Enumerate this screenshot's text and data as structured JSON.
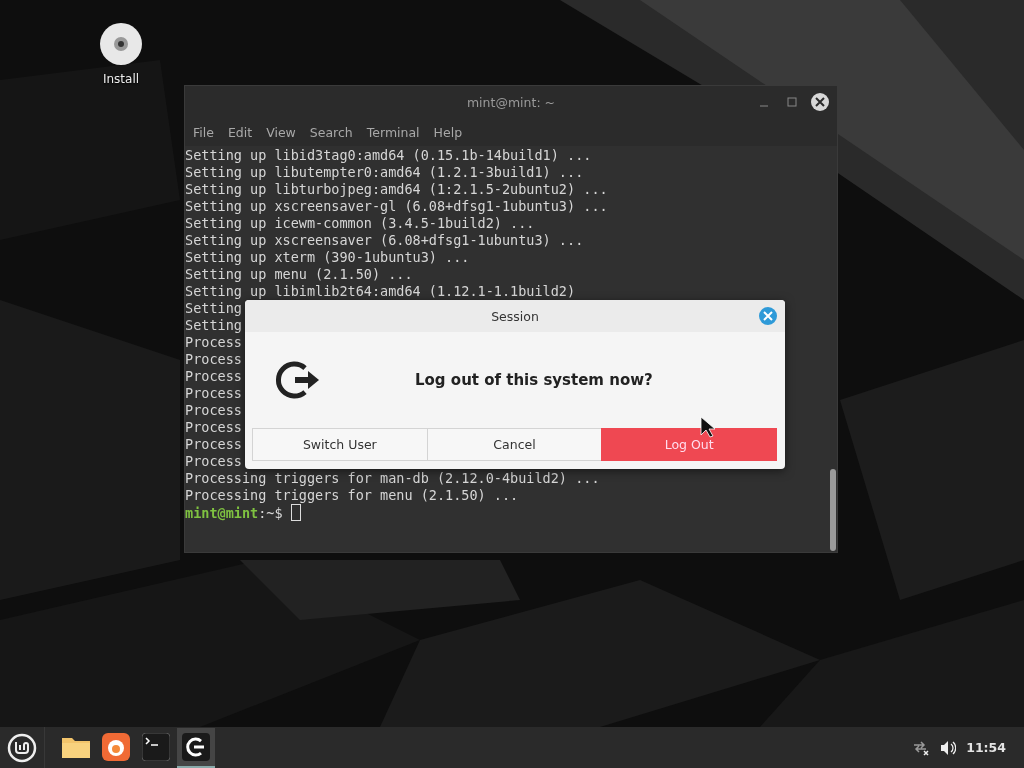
{
  "desktop": {
    "icons": [
      {
        "label": "Install"
      }
    ]
  },
  "terminal": {
    "title": "mint@mint: ~",
    "menu": [
      "File",
      "Edit",
      "View",
      "Search",
      "Terminal",
      "Help"
    ],
    "lines": [
      "Setting up libid3tag0:amd64 (0.15.1b-14build1) ...",
      "Setting up libutempter0:amd64 (1.2.1-3build1) ...",
      "Setting up libturbojpeg:amd64 (1:2.1.5-2ubuntu2) ...",
      "Setting up xscreensaver-gl (6.08+dfsg1-1ubuntu3) ...",
      "Setting up icewm-common (3.4.5-1build2) ...",
      "Setting up xscreensaver (6.08+dfsg1-1ubuntu3) ...",
      "Setting up xterm (390-1ubuntu3) ...",
      "Setting up menu (2.1.50) ...",
      "Setting up libimlib2t64:amd64 (1.12.1-1.1build2)",
      "Setting",
      "Setting",
      "Process",
      "Process",
      "Process",
      "Process",
      "Process",
      "Process",
      "Process",
      "Process",
      "Processing triggers for man-db (2.12.0-4build2) ...",
      "Processing triggers for menu (2.1.50) ..."
    ],
    "prompt": {
      "user": "mint@mint",
      "path": ":~$"
    }
  },
  "dialog": {
    "title": "Session",
    "message": "Log out of this system now?",
    "buttons": [
      {
        "label": "Switch User",
        "kind": "plain"
      },
      {
        "label": "Cancel",
        "kind": "plain"
      },
      {
        "label": "Log Out",
        "kind": "danger"
      }
    ]
  },
  "taskbar": {
    "apps": [
      {
        "kind": "files",
        "selected": false
      },
      {
        "kind": "browser",
        "selected": false
      },
      {
        "kind": "terminal",
        "selected": false
      },
      {
        "kind": "session",
        "selected": true
      }
    ],
    "clock": "11:54"
  }
}
